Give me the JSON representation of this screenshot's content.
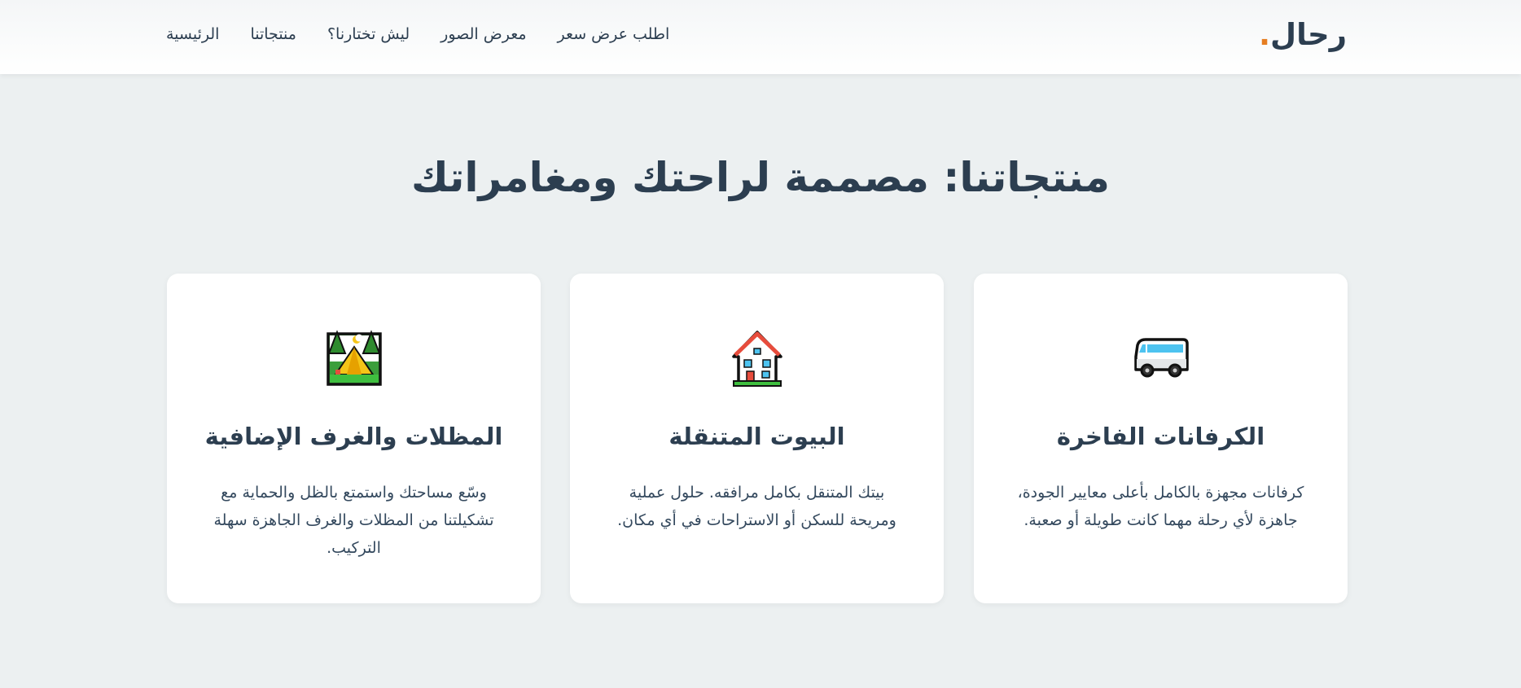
{
  "brand": {
    "name": "رحال",
    "dot": ".",
    "accent_color": "#e67e22",
    "text_color": "#2c3e50"
  },
  "nav": {
    "items": [
      {
        "label": "الرئيسية"
      },
      {
        "label": "منتجاتنا"
      },
      {
        "label": "ليش تختارنا؟"
      },
      {
        "label": "معرض الصور"
      },
      {
        "label": "اطلب عرض سعر"
      }
    ]
  },
  "products": {
    "title": "منتجاتنا: مصممة لراحتك ومغامراتك",
    "cards": [
      {
        "icon": "caravan-icon",
        "title": "الكرفانات الفاخرة",
        "description": "كرفانات مجهزة بالكامل بأعلى معايير الجودة، جاهزة لأي رحلة مهما كانت طويلة أو صعبة."
      },
      {
        "icon": "house-icon",
        "title": "البيوت المتنقلة",
        "description": "بيتك المتنقل بكامل مرافقه. حلول عملية ومريحة للسكن أو الاستراحات في أي مكان."
      },
      {
        "icon": "tent-icon",
        "title": "المظلات والغرف الإضافية",
        "description": "وسّع مساحتك واستمتع بالظل والحماية مع تشكيلتنا من المظلات والغرف الجاهزة سهلة التركيب."
      }
    ]
  },
  "colors": {
    "page_background": "#ecf0f1",
    "card_background": "#ffffff"
  }
}
